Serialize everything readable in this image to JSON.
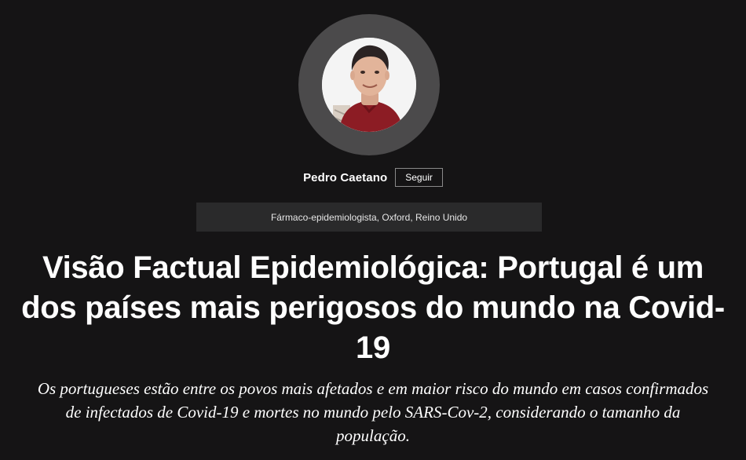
{
  "author": {
    "name": "Pedro Caetano",
    "follow_label": "Seguir",
    "role": "Fármaco-epidemiologista, Oxford, Reino Unido"
  },
  "article": {
    "headline": "Visão Factual Epidemiológica: Portugal é um dos países mais perigosos do mundo na Covid-19",
    "subtitle": "Os portugueses estão entre os povos mais afetados e em maior risco do mundo em casos confirmados de infectados de Covid-19 e mortes no mundo pelo SARS-Cov-2, considerando o tamanho da população."
  },
  "colors": {
    "background": "#151415",
    "avatar_ring": "#4b4a4b",
    "role_bar": "#2a2a2b",
    "text": "#ffffff"
  }
}
